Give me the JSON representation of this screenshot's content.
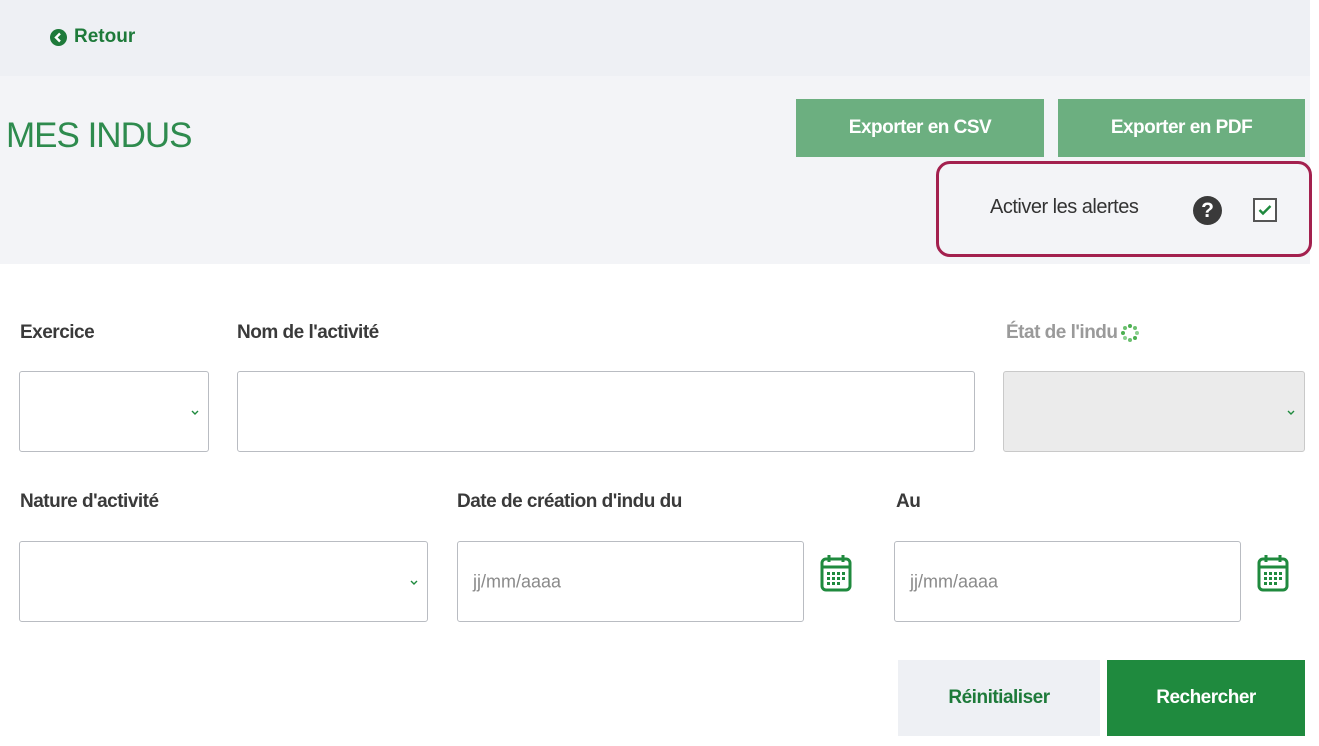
{
  "nav": {
    "back_label": "Retour",
    "back_icon": "arrow-left-circle-icon"
  },
  "header": {
    "title": "MES INDUS",
    "export_csv_label": "Exporter en CSV",
    "export_pdf_label": "Exporter en PDF"
  },
  "alerts": {
    "label": "Activer les alertes",
    "checked": true,
    "help_icon": "question-circle-icon"
  },
  "filters": {
    "exercice": {
      "label": "Exercice",
      "value": ""
    },
    "nom_activite": {
      "label": "Nom de l'activité",
      "value": ""
    },
    "etat_indu": {
      "label": "État de l'indu",
      "value": "",
      "disabled": true
    },
    "nature_activite": {
      "label": "Nature d'activité",
      "value": ""
    },
    "date_du": {
      "label": "Date de création d'indu du",
      "placeholder": "jj/mm/aaaa"
    },
    "date_au": {
      "label": "Au",
      "placeholder": "jj/mm/aaaa"
    }
  },
  "actions": {
    "reset_label": "Réinitialiser",
    "search_label": "Rechercher"
  },
  "colors": {
    "brand_green": "#1f8a3e",
    "export_green": "#6caf80",
    "highlight": "#a3204e"
  }
}
